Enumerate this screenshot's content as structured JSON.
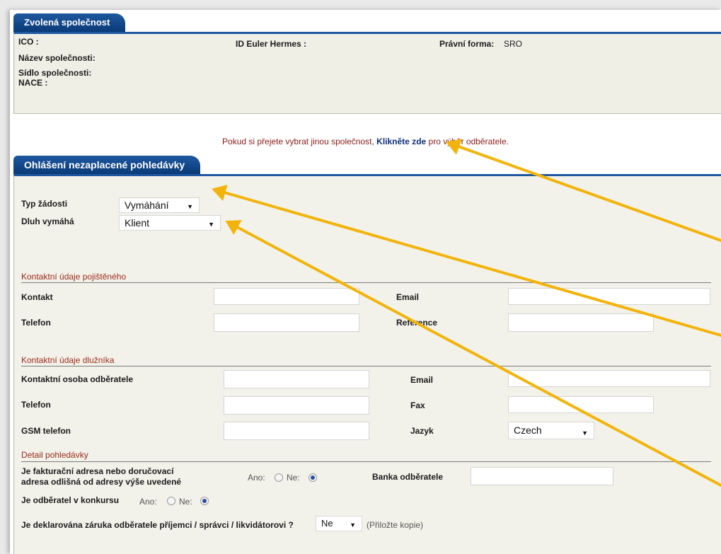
{
  "company": {
    "tab": "Zvolená společnost",
    "ico_label": "ICO :",
    "id_label": "ID Euler Hermes :",
    "pravni_label": "Právní forma:",
    "pravni_value": "SRO",
    "nazev_label": "Název společnosti:",
    "sidlo_label": "Sídlo společnosti:",
    "nace_label": "NACE :"
  },
  "notice": {
    "before": "Pokud si přejete vybrat jinou společnost,",
    "link": "Klikněte zde",
    "after": "pro výběr odběratele."
  },
  "form": {
    "tab": "Ohlášení nezaplacené pohledávky",
    "typ_label": "Typ žádosti",
    "typ_value": "Vymáhání",
    "dluh_label": "Dluh vymáhá",
    "dluh_value": "Klient",
    "insured": {
      "title": "Kontaktní údaje pojištěného",
      "kontakt": "Kontakt",
      "email": "Email",
      "telefon": "Telefon",
      "reference": "Reference"
    },
    "debtor": {
      "title": "Kontaktní údaje dlužníka",
      "osoba": "Kontaktní osoba odběratele",
      "email": "Email",
      "telefon": "Telefon",
      "fax": "Fax",
      "gsm": "GSM telefon",
      "jazyk": "Jazyk",
      "jazyk_value": "Czech"
    },
    "detail": {
      "title": "Detail pohledávky",
      "q1_line1": "Je fakturační adresa nebo doručovací",
      "q1_line2": "adresa odlišná od adresy výše uvedené",
      "ano": "Ano:",
      "ne": "Ne:",
      "banka": "Banka odběratele",
      "q2": "Je odběratel v konkursu",
      "q3": "Je deklarována záruka odběratele příjemci / správci / likvidátorovi ?",
      "q3_value": "Ne",
      "q3_note": "(Přiložte kopie)"
    }
  },
  "colors": {
    "tab_blue": "#1f58a0",
    "arrow": "#f2b40c",
    "section": "#9a2a1a"
  }
}
